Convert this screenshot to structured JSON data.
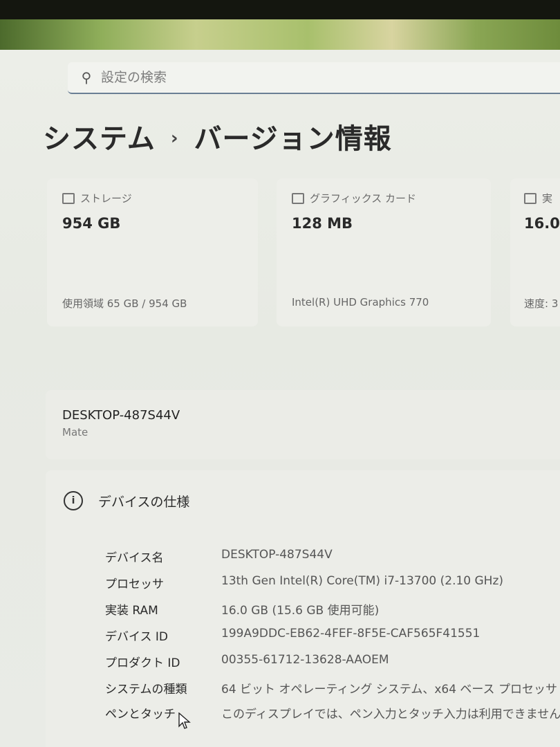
{
  "search": {
    "placeholder": "設定の検索"
  },
  "breadcrumb": {
    "parent": "システム",
    "separator": "›",
    "current": "バージョン情報"
  },
  "cards": [
    {
      "label": "ストレージ",
      "value": "954 GB",
      "sub": "使用領域 65 GB / 954 GB",
      "icon": "storage-icon"
    },
    {
      "label": "グラフィックス カード",
      "value": "128 MB",
      "sub": "Intel(R) UHD Graphics 770",
      "icon": "gpu-icon"
    },
    {
      "label": "実",
      "value": "16.0",
      "sub": "速度: 3",
      "icon": "ram-icon"
    }
  ],
  "device": {
    "name": "DESKTOP-487S44V",
    "model": "Mate"
  },
  "specs": {
    "title": "デバイスの仕様",
    "rows": [
      {
        "key": "デバイス名",
        "value": "DESKTOP-487S44V"
      },
      {
        "key": "プロセッサ",
        "value": "13th Gen Intel(R) Core(TM) i7-13700 (2.10 GHz)"
      },
      {
        "key": "実装 RAM",
        "value": "16.0 GB (15.6 GB 使用可能)"
      },
      {
        "key": "デバイス ID",
        "value": "199A9DDC-EB62-4FEF-8F5E-CAF565F41551"
      },
      {
        "key": "プロダクト ID",
        "value": "00355-61712-13628-AAOEM"
      },
      {
        "key": "システムの種類",
        "value": "64 ビット オペレーティング システム、x64 ベース プロセッサ"
      },
      {
        "key": "ペンとタッチ",
        "value": "このディスプレイでは、ペン入力とタッチ入力は利用できません"
      }
    ]
  }
}
